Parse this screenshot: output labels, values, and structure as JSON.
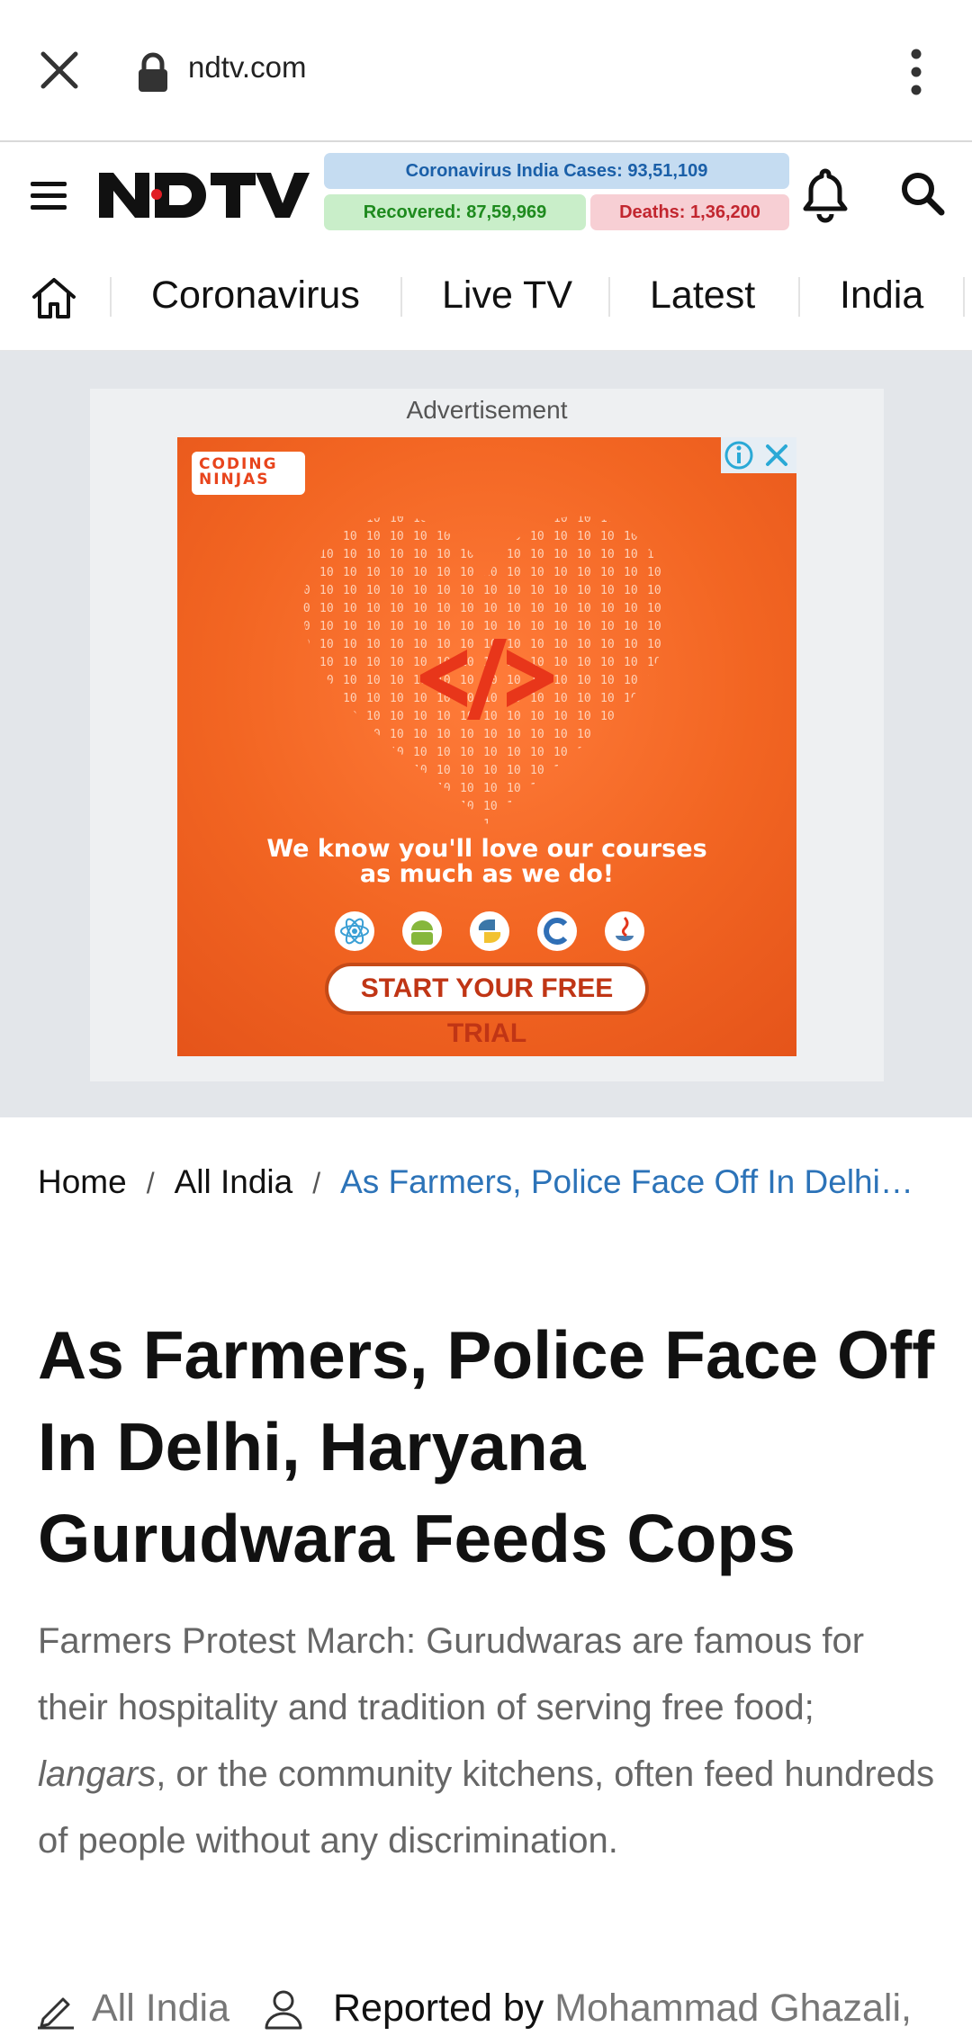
{
  "browser": {
    "url": "ndtv.com"
  },
  "header": {
    "logo_text": "NDTV",
    "covid": {
      "cases": "Coronavirus India Cases: 93,51,109",
      "recovered": "Recovered: 87,59,969",
      "deaths": "Deaths: 1,36,200"
    }
  },
  "nav": {
    "items": [
      "Coronavirus",
      "Live TV",
      "Latest",
      "India"
    ]
  },
  "ad": {
    "label": "Advertisement",
    "brand": "CODING NINJAS",
    "tagline_line1": "We know you'll love our courses",
    "tagline_line2": "as much as we do!",
    "cta": "START YOUR FREE TRIAL"
  },
  "breadcrumb": {
    "home": "Home",
    "section": "All India",
    "current": "As Farmers, Police Face Off In Delhi…"
  },
  "article": {
    "headline": "As Farmers, Police Face Off In Delhi, Haryana Gurudwara Feeds Cops",
    "summary_before": "Farmers Protest March: Gurudwaras are famous for their hospitality and tradition of serving free food; ",
    "summary_em": "langars",
    "summary_after": ", or the community kitchens, often feed hundreds of people without any discrimination.",
    "category": "All India",
    "reported_by_label": "Reported by",
    "author": "Mohammad Ghazali,"
  },
  "colors": {
    "accent_blue": "#2c73b8",
    "logo_red": "#e11d24",
    "ad_orange": "#f26522"
  }
}
